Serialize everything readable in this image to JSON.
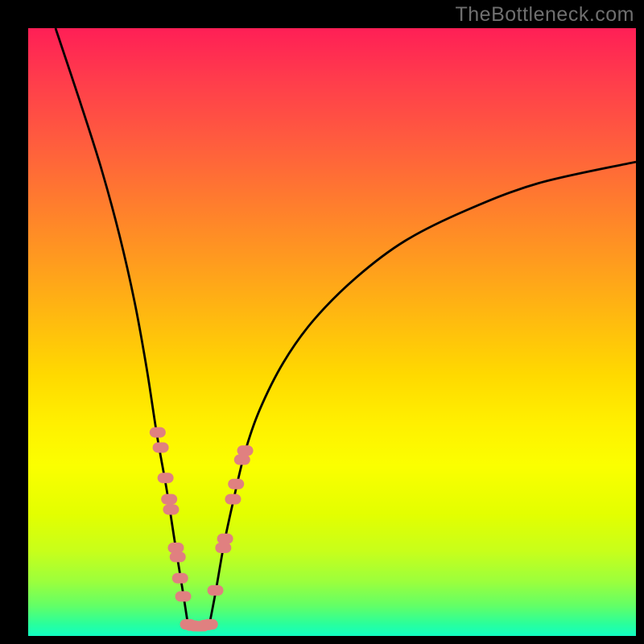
{
  "watermark": "TheBottleneck.com",
  "colors": {
    "curve_stroke": "#000000",
    "marker_fill": "#e08080",
    "marker_stroke": "#e08080",
    "frame": "#000000"
  },
  "chart_data": {
    "type": "line",
    "title": "",
    "xlabel": "",
    "ylabel": "",
    "xlim": [
      0,
      100
    ],
    "ylim": [
      0,
      100
    ],
    "curve": {
      "description": "Absolute-value-style bottleneck curve with minimum near x≈27; left branch steep, right branch shallower and asymptoting near y≈78 at x=100",
      "left_points": [
        {
          "x": 4.5,
          "y": 100
        },
        {
          "x": 8.5,
          "y": 88
        },
        {
          "x": 12,
          "y": 77
        },
        {
          "x": 15,
          "y": 66
        },
        {
          "x": 17.5,
          "y": 55
        },
        {
          "x": 19.5,
          "y": 44
        },
        {
          "x": 21.2,
          "y": 33
        },
        {
          "x": 22.8,
          "y": 24
        },
        {
          "x": 24.2,
          "y": 15
        },
        {
          "x": 25.5,
          "y": 7
        },
        {
          "x": 26.3,
          "y": 1.8
        }
      ],
      "right_points": [
        {
          "x": 29.8,
          "y": 1.8
        },
        {
          "x": 30.8,
          "y": 7
        },
        {
          "x": 32.2,
          "y": 15
        },
        {
          "x": 33.7,
          "y": 22
        },
        {
          "x": 35.6,
          "y": 30
        },
        {
          "x": 38,
          "y": 37
        },
        {
          "x": 42,
          "y": 45
        },
        {
          "x": 47,
          "y": 52
        },
        {
          "x": 54,
          "y": 59
        },
        {
          "x": 62,
          "y": 65
        },
        {
          "x": 72,
          "y": 70
        },
        {
          "x": 84,
          "y": 74.5
        },
        {
          "x": 100,
          "y": 78
        }
      ],
      "bottom_points": [
        {
          "x": 26.3,
          "y": 1.8
        },
        {
          "x": 29.8,
          "y": 1.8
        }
      ]
    },
    "markers": {
      "shape": "rounded-pill",
      "left_cluster": [
        {
          "x": 21.3,
          "y": 33.5
        },
        {
          "x": 21.8,
          "y": 31
        },
        {
          "x": 22.6,
          "y": 26
        },
        {
          "x": 23.2,
          "y": 22.5
        },
        {
          "x": 23.5,
          "y": 20.8
        },
        {
          "x": 24.3,
          "y": 14.5
        },
        {
          "x": 24.6,
          "y": 13
        },
        {
          "x": 25.0,
          "y": 9.5
        },
        {
          "x": 25.5,
          "y": 6.5
        }
      ],
      "right_cluster": [
        {
          "x": 30.8,
          "y": 7.5
        },
        {
          "x": 32.1,
          "y": 14.5
        },
        {
          "x": 32.4,
          "y": 16
        },
        {
          "x": 33.7,
          "y": 22.5
        },
        {
          "x": 34.2,
          "y": 25
        },
        {
          "x": 35.2,
          "y": 29
        },
        {
          "x": 35.7,
          "y": 30.5
        }
      ],
      "bottom_cluster": [
        {
          "x": 26.3,
          "y": 1.9
        },
        {
          "x": 27.0,
          "y": 1.7
        },
        {
          "x": 27.7,
          "y": 1.6
        },
        {
          "x": 28.5,
          "y": 1.6
        },
        {
          "x": 29.3,
          "y": 1.8
        },
        {
          "x": 29.9,
          "y": 1.9
        }
      ]
    }
  }
}
